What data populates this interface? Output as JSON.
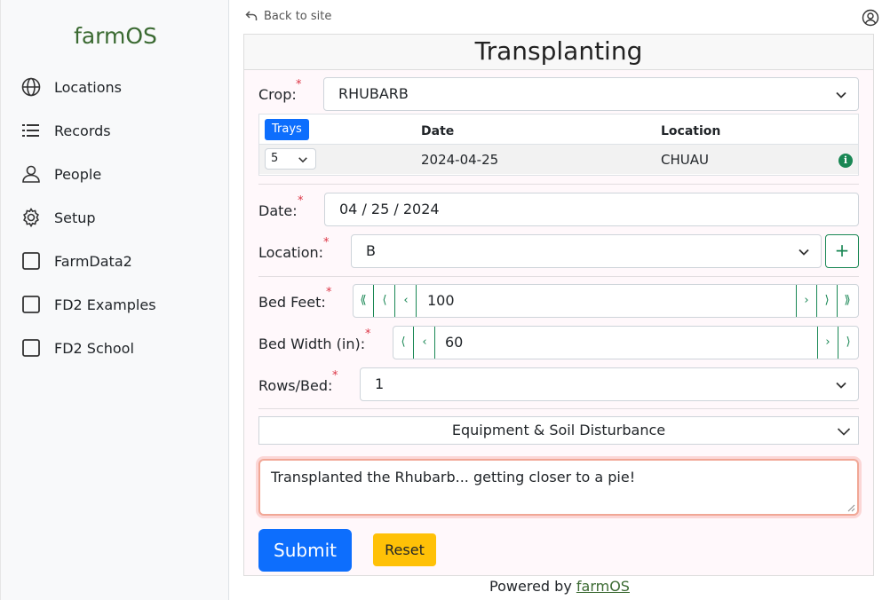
{
  "sidebar": {
    "brand": "farmOS",
    "items": [
      {
        "label": "Locations",
        "icon": "globe-icon"
      },
      {
        "label": "Records",
        "icon": "list-icon"
      },
      {
        "label": "People",
        "icon": "person-icon"
      },
      {
        "label": "Setup",
        "icon": "gear-icon"
      },
      {
        "label": "FarmData2",
        "icon": "checkbox-icon"
      },
      {
        "label": "FD2 Examples",
        "icon": "checkbox-icon"
      },
      {
        "label": "FD2 School",
        "icon": "checkbox-icon"
      }
    ]
  },
  "topbar": {
    "back_label": "Back to site",
    "user_icon": "user-circle-icon"
  },
  "form": {
    "title": "Transplanting",
    "crop": {
      "label": "Crop:",
      "value": "RHUBARB"
    },
    "trays_table": {
      "badge": "Trays",
      "headers": {
        "date": "Date",
        "location": "Location"
      },
      "rows": [
        {
          "trays": "5",
          "date": "2024-04-25",
          "location": "CHUAU",
          "info": "i"
        }
      ]
    },
    "date": {
      "label": "Date:",
      "value": "04 / 25 / 2024"
    },
    "location": {
      "label": "Location:",
      "value": "B",
      "add_label": "+"
    },
    "bed_feet": {
      "label": "Bed Feet:",
      "value": "100",
      "btn_dec3": "⟪",
      "btn_dec2": "⟨",
      "btn_dec1": "‹",
      "btn_inc1": "›",
      "btn_inc2": "⟩",
      "btn_inc3": "⟫"
    },
    "bed_width": {
      "label": "Bed Width (in):",
      "value": "60",
      "btn_dec2": "⟨",
      "btn_dec1": "‹",
      "btn_inc1": "›",
      "btn_inc2": "⟩"
    },
    "rows_bed": {
      "label": "Rows/Bed:",
      "value": "1"
    },
    "required_mark": "*",
    "accordion_label": "Equipment & Soil Disturbance",
    "comment": "Transplanted the Rhubarb... getting closer to a pie!",
    "submit_label": "Submit",
    "reset_label": "Reset"
  },
  "footer": {
    "prefix": "Powered by ",
    "link": "farmOS"
  },
  "colors": {
    "primary": "#0d6efd",
    "success": "#198754",
    "warning": "#ffc107",
    "danger": "#dc3545",
    "brand": "#3b6a32"
  }
}
